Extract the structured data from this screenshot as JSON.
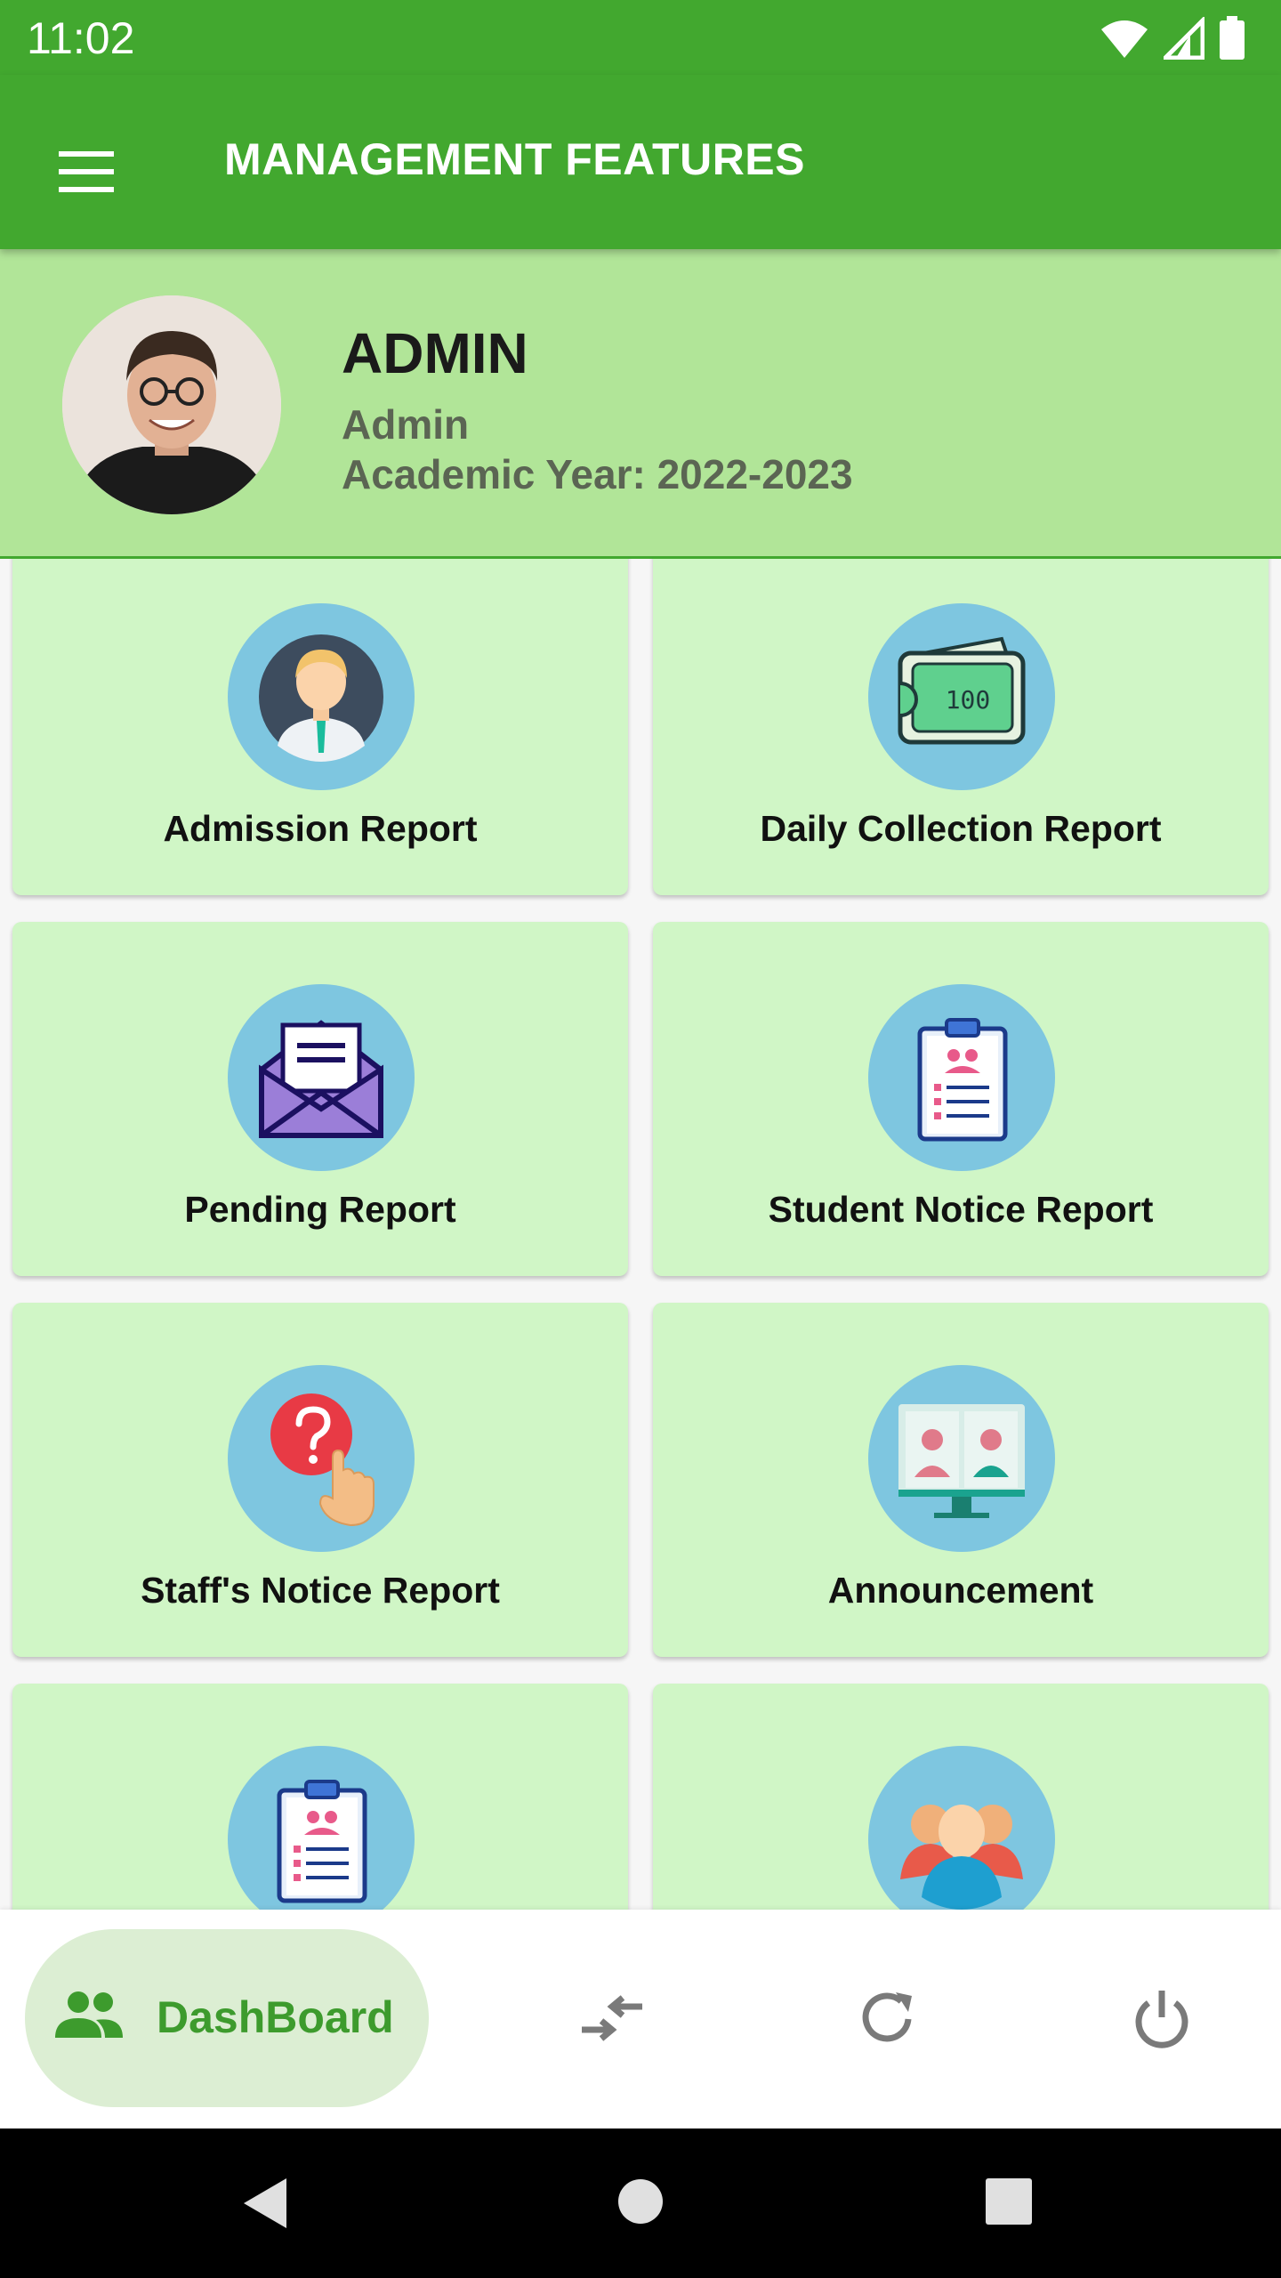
{
  "status_bar": {
    "time": "11:02"
  },
  "app_bar": {
    "title": "MANAGEMENT FEATURES"
  },
  "profile": {
    "name": "ADMIN",
    "role": "Admin",
    "academic_year": "Academic Year: 2022-2023"
  },
  "features": [
    {
      "label": "Admission Report",
      "icon": "student-avatar-icon"
    },
    {
      "label": "Daily Collection Report",
      "icon": "money-wallet-icon"
    },
    {
      "label": "Pending Report",
      "icon": "envelope-icon"
    },
    {
      "label": "Student Notice Report",
      "icon": "clipboard-icon"
    },
    {
      "label": "Staff's Notice Report",
      "icon": "question-pointer-icon"
    },
    {
      "label": "Announcement",
      "icon": "video-call-monitor-icon"
    },
    {
      "label": "",
      "icon": "clipboard-icon"
    },
    {
      "label": "",
      "icon": "group-people-icon"
    }
  ],
  "bottom_nav": {
    "dashboard_label": "DashBoard",
    "items": [
      "switch-icon",
      "refresh-icon",
      "power-icon"
    ]
  },
  "colors": {
    "primary": "#42a82f",
    "profile_bg": "#b1e598",
    "card_bg": "#d0f6c6",
    "icon_circle": "#7ec6e0"
  }
}
